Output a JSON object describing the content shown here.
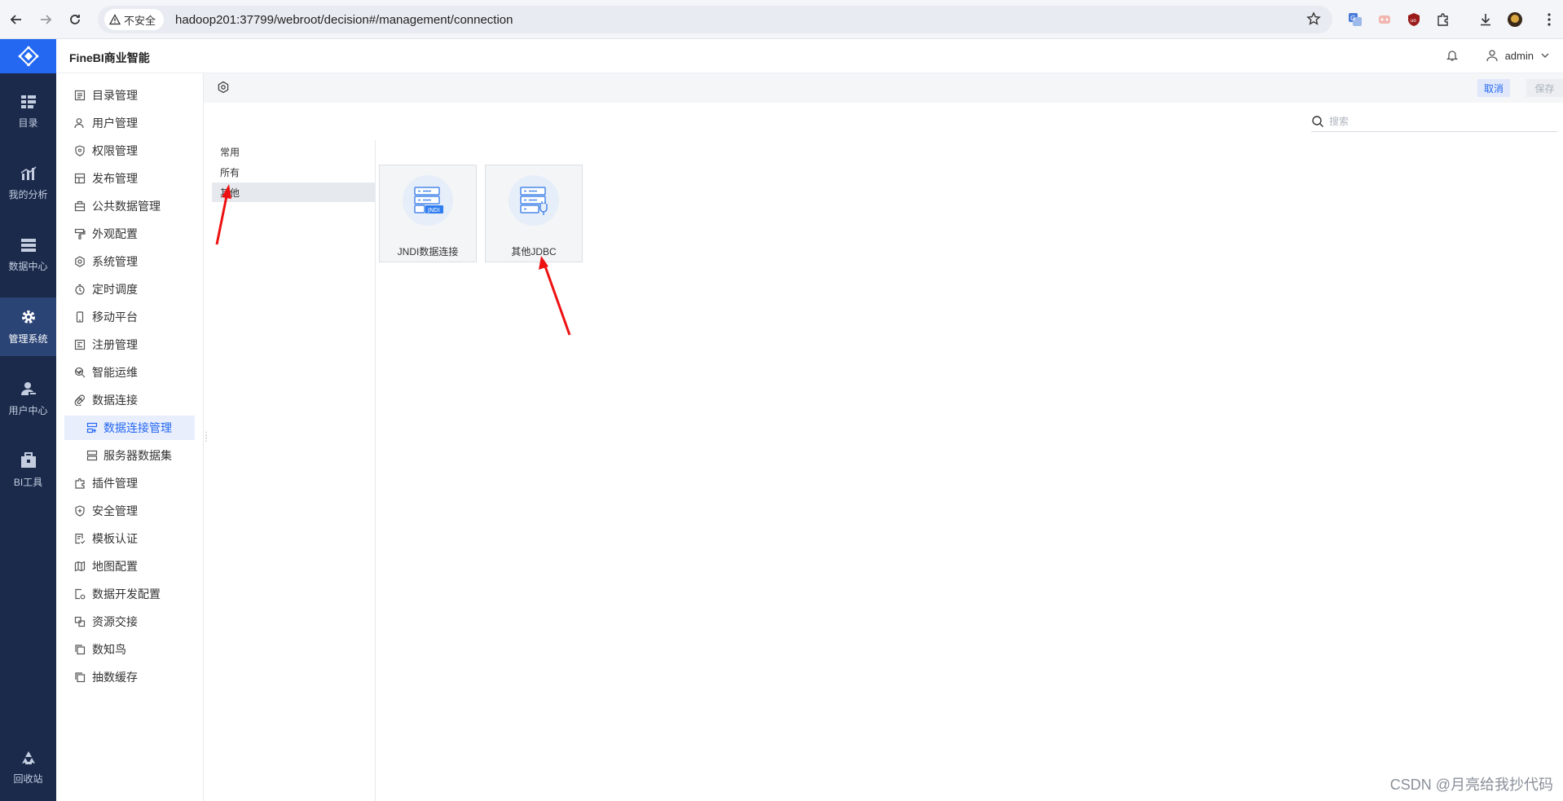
{
  "browser": {
    "security_label": "不安全",
    "url": "hadoop201:37799/webroot/decision#/management/connection"
  },
  "rail": {
    "items": [
      {
        "label": "目录",
        "icon": "catalog-icon"
      },
      {
        "label": "我的分析",
        "icon": "analysis-icon"
      },
      {
        "label": "数据中心",
        "icon": "data-center-icon"
      },
      {
        "label": "管理系统",
        "icon": "gear-icon",
        "active": true
      },
      {
        "label": "用户中心",
        "icon": "user-center-icon"
      },
      {
        "label": "BI工具",
        "icon": "toolbox-icon"
      },
      {
        "label": "回收站",
        "icon": "recycle-icon"
      }
    ]
  },
  "header": {
    "brand": "FineBI商业智能",
    "user": "admin"
  },
  "menu": {
    "items": [
      {
        "label": "目录管理"
      },
      {
        "label": "用户管理"
      },
      {
        "label": "权限管理"
      },
      {
        "label": "发布管理"
      },
      {
        "label": "公共数据管理"
      },
      {
        "label": "外观配置"
      },
      {
        "label": "系统管理"
      },
      {
        "label": "定时调度"
      },
      {
        "label": "移动平台"
      },
      {
        "label": "注册管理"
      },
      {
        "label": "智能运维"
      },
      {
        "label": "数据连接"
      },
      {
        "label": "数据连接管理"
      },
      {
        "label": "服务器数据集"
      },
      {
        "label": "插件管理"
      },
      {
        "label": "安全管理"
      },
      {
        "label": "模板认证"
      },
      {
        "label": "地图配置"
      },
      {
        "label": "数据开发配置"
      },
      {
        "label": "资源交接"
      },
      {
        "label": "数知鸟"
      },
      {
        "label": "抽数缓存"
      }
    ]
  },
  "toolbar": {
    "cancel": "取消",
    "save": "保存"
  },
  "search": {
    "placeholder": "搜索"
  },
  "categories": [
    "常用",
    "所有",
    "其他"
  ],
  "selected_category": "其他",
  "cards": [
    {
      "label": "JNDI数据连接",
      "badge": "JNDI"
    },
    {
      "label": "其他JDBC"
    }
  ],
  "watermark": "CSDN @月亮给我抄代码",
  "colors": {
    "rail_bg": "#1b2a4b",
    "accent": "#2468f2",
    "annotation_arrow": "#ee1111"
  }
}
